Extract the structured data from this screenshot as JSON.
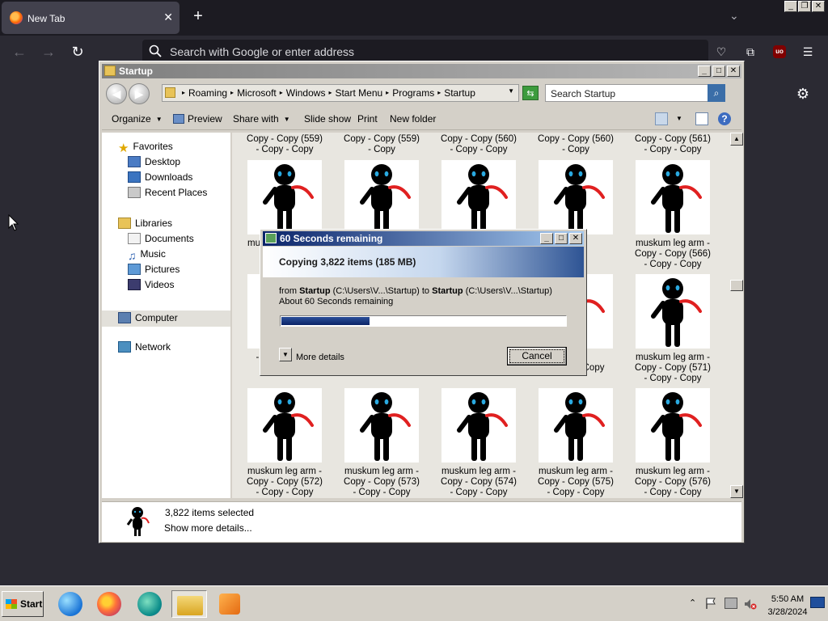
{
  "browser": {
    "tab_title": "New Tab",
    "urlbar_placeholder": "Search with Google or enter address"
  },
  "explorer": {
    "title": "Startup",
    "breadcrumbs": [
      "Roaming",
      "Microsoft",
      "Windows",
      "Start Menu",
      "Programs",
      "Startup"
    ],
    "search_placeholder": "Search Startup",
    "toolbar": {
      "organize": "Organize",
      "preview": "Preview",
      "share": "Share with",
      "slideshow": "Slide show",
      "print": "Print",
      "new_folder": "New folder"
    },
    "nav": {
      "favorites": "Favorites",
      "desktop": "Desktop",
      "downloads": "Downloads",
      "recent": "Recent Places",
      "libraries": "Libraries",
      "documents": "Documents",
      "music": "Music",
      "pictures": "Pictures",
      "videos": "Videos",
      "computer": "Computer",
      "network": "Network"
    },
    "top_partial_labels": [
      "Copy - Copy (559)\n- Copy - Copy",
      "Copy - Copy (559)\n- Copy",
      "Copy - Copy (560)\n- Copy - Copy",
      "Copy - Copy (560)\n- Copy",
      "Copy - Copy (561)\n- Copy - Copy"
    ],
    "row1_labels": [
      "muskum leg arm -\nCo",
      "",
      "",
      "(565)\npy",
      "muskum leg arm -\nCopy - Copy (566)\n- Copy - Copy"
    ],
    "row2_labels": [
      "- Copy - Copy",
      "- Copy - Copy",
      "- Copy - Copy",
      "(570)\n- Copy - Copy",
      "muskum leg arm -\nCopy - Copy (571)\n- Copy - Copy"
    ],
    "row2_partial_left": "muskum leg arm -\nCo",
    "row3_labels": [
      "muskum leg arm -\nCopy - Copy (572)\n- Copy - Copy",
      "muskum leg arm -\nCopy - Copy (573)\n- Copy - Copy",
      "muskum leg arm -\nCopy - Copy (574)\n- Copy - Copy",
      "muskum leg arm -\nCopy - Copy (575)\n- Copy - Copy",
      "muskum leg arm -\nCopy - Copy (576)\n- Copy - Copy"
    ],
    "details": {
      "count": "3,822 items selected",
      "more": "Show more details..."
    }
  },
  "copy_dialog": {
    "title": "60 Seconds remaining",
    "heading": "Copying 3,822 items (185 MB)",
    "from_label": "from",
    "from_name": "Startup",
    "from_path": "(C:\\Users\\V...\\Startup)",
    "to_label": "to",
    "to_name": "Startup",
    "to_path": "(C:\\Users\\V...\\Startup)",
    "remaining": "About 60 Seconds remaining",
    "progress_fraction": 0.31,
    "more_details": "More details",
    "cancel": "Cancel"
  },
  "taskbar": {
    "start": "Start",
    "time": "5:50 AM",
    "date": "3/28/2024"
  }
}
